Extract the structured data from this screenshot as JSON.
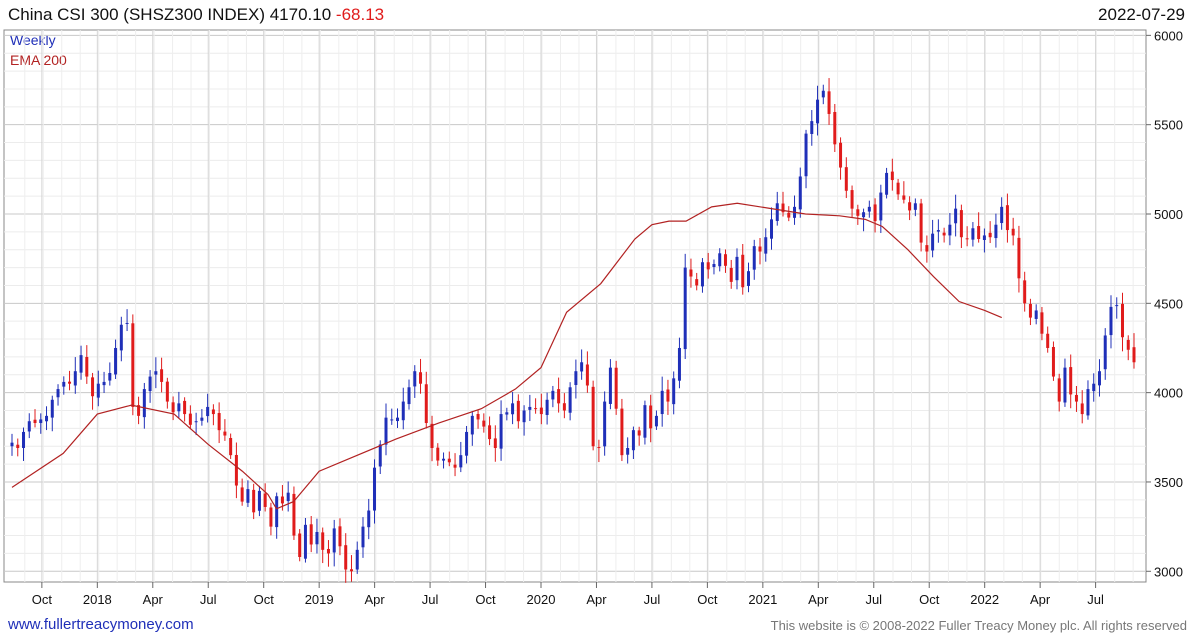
{
  "header": {
    "title": "China CSI 300 (SHSZ300 INDEX) 4170.10",
    "change": "-68.13",
    "date": "2022-07-29"
  },
  "legend": {
    "weekly": "Weekly",
    "ema": "EMA 200"
  },
  "footer": {
    "url": "www.fullertreacymoney.com",
    "copyright": "This website is © 2008-2022 Fuller Treacy Money plc. All rights reserved"
  },
  "colors": {
    "up": "#1f2fb8",
    "down": "#e01b1b",
    "ema": "#b22222",
    "grid": "#d8d8d8"
  },
  "chart_data": {
    "type": "candlestick",
    "title": "China CSI 300 (SHSZ300 INDEX)",
    "frequency": "Weekly",
    "x_ticks": [
      "Oct",
      "2018",
      "Apr",
      "Jul",
      "Oct",
      "2019",
      "Apr",
      "Jul",
      "Oct",
      "2020",
      "Apr",
      "Jul",
      "Oct",
      "2021",
      "Apr",
      "Jul",
      "Oct",
      "2022",
      "Apr",
      "Jul"
    ],
    "x_tick_weeks": [
      7,
      20,
      33,
      46,
      59,
      72,
      85,
      98,
      111,
      124,
      137,
      150,
      163,
      176,
      189,
      202,
      215,
      228,
      241,
      254
    ],
    "y_ticks": [
      3000,
      3500,
      4000,
      4500,
      5000,
      5500,
      6000
    ],
    "ylim": [
      2940,
      6030
    ],
    "total_weeks": 264,
    "grid": true,
    "series": [
      {
        "name": "Weekly",
        "type": "candles",
        "comment": "approximate weekly closes, one value per week",
        "closes": [
          3720,
          3690,
          3780,
          3840,
          3830,
          3850,
          3870,
          3960,
          4020,
          4060,
          4050,
          4120,
          4210,
          4090,
          3980,
          4050,
          4060,
          4110,
          4250,
          4380,
          4390,
          3920,
          3870,
          4020,
          4090,
          4120,
          4060,
          3950,
          3890,
          3940,
          3880,
          3820,
          3840,
          3860,
          3920,
          3880,
          3790,
          3760,
          3650,
          3480,
          3390,
          3460,
          3330,
          3450,
          3360,
          3250,
          3420,
          3380,
          3440,
          3200,
          3080,
          3260,
          3150,
          3220,
          3120,
          3100,
          3240,
          3140,
          3010,
          3000,
          3120,
          3250,
          3340,
          3580,
          3710,
          3860,
          3850,
          3860,
          3950,
          4030,
          4120,
          4050,
          3830,
          3690,
          3620,
          3630,
          3610,
          3580,
          3650,
          3780,
          3870,
          3850,
          3810,
          3740,
          3690,
          3880,
          3890,
          3940,
          3840,
          3900,
          3920,
          3910,
          3880,
          3960,
          4010,
          3940,
          3900,
          4030,
          4120,
          4170,
          4040,
          3700,
          3690,
          3950,
          4140,
          3910,
          3650,
          3690,
          3790,
          3760,
          3930,
          3800,
          3870,
          4010,
          3950,
          4080,
          4250,
          4700,
          4650,
          4600,
          4730,
          4690,
          4720,
          4780,
          4710,
          4620,
          4760,
          4590,
          4680,
          4820,
          4790,
          4870,
          4970,
          5060,
          5010,
          4980,
          5040,
          5210,
          5450,
          5520,
          5640,
          5690,
          5560,
          5390,
          5260,
          5130,
          5030,
          4990,
          5010,
          5040,
          4960,
          5120,
          5230,
          5190,
          5110,
          5080,
          5020,
          5060,
          4840,
          4790,
          4890,
          4910,
          4880,
          4940,
          5030,
          4870,
          4860,
          4920,
          4860,
          4880,
          4870,
          4940,
          5040,
          4910,
          4880,
          4640,
          4500,
          4420,
          4460,
          4330,
          4250,
          4090,
          3950,
          4140,
          3990,
          3950,
          3880,
          4020,
          4050,
          4120,
          4320,
          4480,
          4490,
          4310,
          4240,
          4170
        ],
        "note": "closes list covers the plotted weekly candles from left to right"
      },
      {
        "name": "EMA 200",
        "type": "line",
        "keypoints": [
          [
            0,
            3470
          ],
          [
            12,
            3660
          ],
          [
            20,
            3880
          ],
          [
            28,
            3930
          ],
          [
            38,
            3880
          ],
          [
            46,
            3710
          ],
          [
            54,
            3560
          ],
          [
            60,
            3430
          ],
          [
            62,
            3350
          ],
          [
            66,
            3390
          ],
          [
            72,
            3560
          ],
          [
            80,
            3640
          ],
          [
            90,
            3740
          ],
          [
            100,
            3830
          ],
          [
            110,
            3910
          ],
          [
            118,
            4020
          ],
          [
            124,
            4140
          ],
          [
            130,
            4450
          ],
          [
            138,
            4610
          ],
          [
            146,
            4860
          ],
          [
            150,
            4940
          ],
          [
            154,
            4960
          ],
          [
            158,
            4960
          ],
          [
            164,
            5040
          ],
          [
            170,
            5060
          ],
          [
            178,
            5030
          ],
          [
            186,
            5000
          ],
          [
            194,
            4990
          ],
          [
            200,
            4970
          ],
          [
            204,
            4930
          ],
          [
            210,
            4800
          ],
          [
            216,
            4650
          ],
          [
            222,
            4510
          ],
          [
            228,
            4460
          ],
          [
            232,
            4420
          ]
        ]
      }
    ]
  }
}
